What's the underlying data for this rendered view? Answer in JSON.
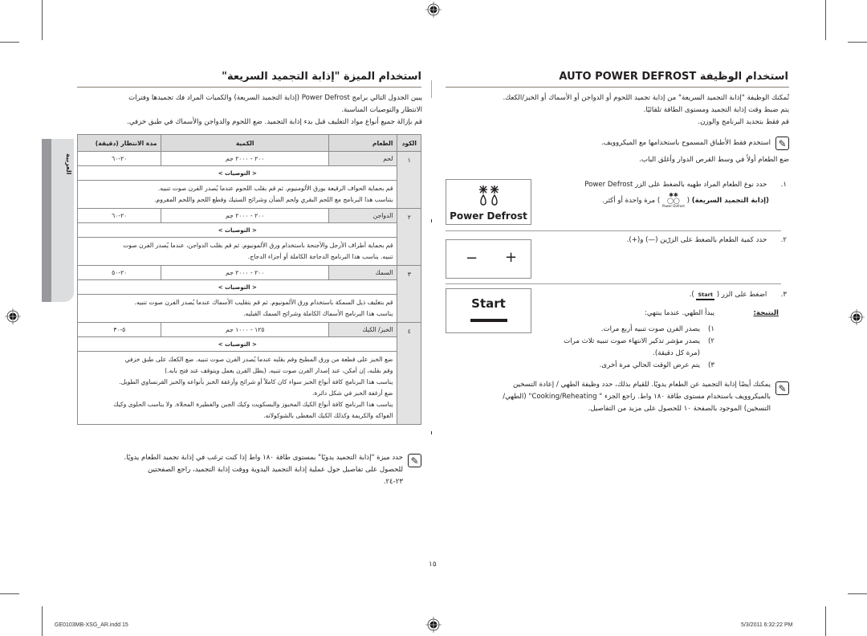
{
  "page": {
    "page_number": "١٥",
    "footer_left": "GE0103MB-XSG_AR.indd   15",
    "footer_right": "5/3/2011   6:32:22 PM"
  },
  "side_tab": {
    "label": "العربية"
  },
  "left": {
    "title": "استخدام الميزة \"إذابة التجميد السريعة\"",
    "intro_lines": [
      "يبين الجدول التالي برامج Power Defrost (إذابة التجميد السريعة) والكميات المراد فك تجميدها وفترات",
      "الانتظار والتوصيات المناسبة.",
      "قم بإزالة جميع أنواع مواد التغليف قبل بدء إذابة التجميد. ضع اللحوم والدواجن والأسماك في طبق خزفي."
    ],
    "table": {
      "headers": {
        "code": "الكود",
        "food": "الطعام",
        "quantity": "الكمية",
        "wait": "مدة الانتظار (دقيقة)"
      },
      "recommendations_label": "< التوصيات >",
      "rows": [
        {
          "code": "١",
          "food": "لحم",
          "quantity": "٢٠٠ - ٢٠٠٠ جم",
          "wait": "٢٠-٦٠",
          "recommendations": [
            "قم بحماية الحواف الرقيعة بورق الألومنيوم. ثم قم بقلب اللحوم عندما يُصدر الفرن صوت تنبيه.",
            "يتناسب هذا البرنامج مع اللحم البقري ولحم الضأن وشرائح الستيك وقطع اللحم واللحم المفروم."
          ]
        },
        {
          "code": "٢",
          "food": "الدواجن",
          "quantity": "٢٠٠ - ٢٠٠٠ جم",
          "wait": "٢٠-٦٠",
          "recommendations": [
            "قم بحماية أطراف الأرجل والأجنحة باستخدام ورق الألمونيوم. ثم قم بقلب الدواجن، عندما يُصدر الفرن صوت",
            "تنبيه. يناسب هذا البرنامج الدجاجة الكاملة أو أجزاء الدجاج."
          ]
        },
        {
          "code": "٣",
          "food": "السمك",
          "quantity": "٢٠٠ - ٢٠٠٠ جم",
          "wait": "٢٠-٥٠",
          "recommendations": [
            "قم بتغليف ذيل السمكة باستخدام ورق الألمونيوم. ثم قم بتقليب الأسماك عندما يُصدر الفرن صوت تنبيه.",
            "يناسب هذا البرنامج الأسماك الكاملة وشرائح السمك الفيليه."
          ]
        },
        {
          "code": "٤",
          "food": "الخبز/ الكيك",
          "quantity": "١٢٥ - ١٠٠٠ جم",
          "wait": "٥-٣٠",
          "recommendations": [
            "ضع الخبز على قطعة من ورق المطبخ وقم بقلبه عندما يُصدر الفرن صوت تنبيه. ضع الكعك على طبق خزفي",
            "وقم بقلبه، إن أمكن، عند إصدار الفرن صوت تنبيه. (يظل الفرن يعمل ويتوقف عند فتح بابه.)",
            "يناسب هذا البرنامج كافة أنواع الخبز سواء كان كاملاً أو شرائح وأرغفة الخبز بأنواعه والخبز الفرنساوي الطويل.",
            "ضع أرغفة الخبز في شكل دائرة.",
            "يناسب هذا البرنامج كافة أنواع الكيك المخبوز والبسكويت وكيك الجبن والفطيرة المحلاة. ولا يناسب الحلوى وكيك",
            "الفواكه والكريمة وكذلك الكيك المغطى بالشوكولاته."
          ]
        }
      ]
    },
    "note_lines": [
      "حدد ميزة \"إذابة التجميد يدويًا\" بمستوى طاقة ١٨٠ واط إذا كنت ترغب في إذابة تجميد الطعام يدويًا.",
      "للحصول على تفاصيل حول عملية إذابة التجميد اليدوية ووقت إذابة التجميد، راجع الصفحتين",
      "٢٣-٢٤."
    ]
  },
  "right": {
    "title": "استخدام الوظيفة AUTO POWER DEFROST",
    "intro_lines": [
      "تُمكنك الوظيفة \"إذابة التجميد السريعة\" من إذابة تجميد اللحوم أو الدواجن أو الأسماك أو الخبز/الكعك.",
      "يتم ضبط وقت إذابة التجميد ومستوى الطاقة تلقائيًا.",
      "قم فقط بتحديد البرنامج والوزن."
    ],
    "note_1": "استخدم فقط الأطباق المسموح باستخدامها مع الميكروويف.",
    "place_food": "ضع الطعام أولاً في وسط القرص الدوار وأغلق الباب.",
    "steps": [
      {
        "number": "١.",
        "line1": "حدد نوع الطعام المراد طهيه بالضغط على الزر Power Defrost",
        "line2_bold": "(إذابة التجميد السريعة)",
        "line2_rest": "مرة واحدة أو أكثر.",
        "inline_icon_label": "Power Defrost",
        "button_label": "Power Defrost",
        "button_icon": "snowflake-drops-icon"
      },
      {
        "number": "٢.",
        "line1": "حدد كمية الطعام بالضغط على الزرّين (—) و(+).",
        "button_minus": "−",
        "button_plus": "+"
      },
      {
        "number": "٣.",
        "line1_pre": "اضغط على الزر (",
        "inline_button": "Start",
        "line1_post": ").",
        "button_label": "Start",
        "result_label": "النتيجة:",
        "result_text": "يبدأ الطهي. عندما ينتهي:",
        "result_items": [
          {
            "n": "١)",
            "text": "يصدر الفرن صوت تنبيه أربع مرات."
          },
          {
            "n": "٢)",
            "text": "يصدر مؤشر تذكير الانتهاء صوت تنبيه ثلاث مرات"
          },
          {
            "n": "",
            "text": "(مرة كل دقيقة)."
          },
          {
            "n": "٣)",
            "text": "يتم عرض الوقت الحالي مرة أخرى."
          }
        ]
      }
    ],
    "note_2_lines": [
      "يمكنك أيضًا إذابة التجميد عن الطعام يدويًا. للقيام بذلك، حدد وظيفة الطهي / إعادة التسخين",
      "بالميكروويف باستخدام مستوى طاقة ١٨٠ واط. راجع الجزء \" Cooking/Reheating\" (الطهي/",
      "التسخين) الموجود بالصفحة ١٠ للحصول على مزيد من التفاصيل."
    ]
  }
}
